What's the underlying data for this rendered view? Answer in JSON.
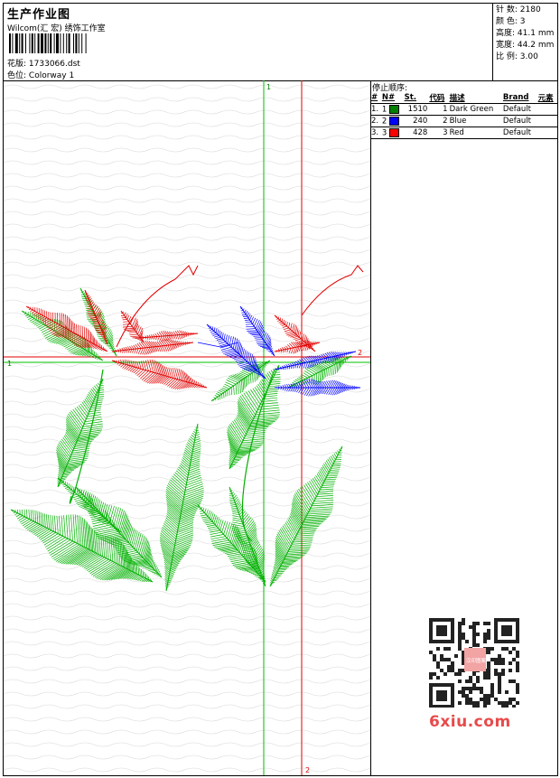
{
  "header": {
    "title": "生产作业图",
    "company": "Wilcom(汇 宏) 绣饰工作室",
    "design_label": "花版:",
    "design_value": "1733066.dst",
    "colorway_label": "色位:",
    "colorway_value": "Colorway 1"
  },
  "stats": [
    {
      "label": "针 数:",
      "value": "2180"
    },
    {
      "label": "颜 色:",
      "value": "3"
    },
    {
      "label": "高度:",
      "value": "41.1 mm"
    },
    {
      "label": "宽度:",
      "value": "44.2 mm"
    },
    {
      "label": "比 例:",
      "value": "3.00"
    }
  ],
  "stop_sequence": {
    "title": "停止顺序:",
    "columns": [
      "#",
      "N#",
      "St.",
      "代码",
      "描述",
      "Brand",
      "元素"
    ],
    "rows": [
      {
        "idx": "1.",
        "n": "1",
        "color": "#008000",
        "st": "1510",
        "code": "1",
        "desc": "Dark Green",
        "brand": "Default"
      },
      {
        "idx": "2.",
        "n": "2",
        "color": "#0000ff",
        "st": "240",
        "code": "2",
        "desc": "Blue",
        "brand": "Default"
      },
      {
        "idx": "3.",
        "n": "3",
        "color": "#ff0000",
        "st": "428",
        "code": "3",
        "desc": "Red",
        "brand": "Default"
      }
    ]
  },
  "canvas": {
    "axis_labels": {
      "v_green_top": "1",
      "h_green_left": "1",
      "h_red_right": "2",
      "v_red_bottom": "2"
    },
    "colors": {
      "green": "#00b000",
      "red": "#e00000",
      "blue": "#0000ff",
      "dark_green": "#1a9a1a"
    }
  },
  "watermark": {
    "text": "6xiu.com",
    "qr_center_text": "汉印图案"
  }
}
